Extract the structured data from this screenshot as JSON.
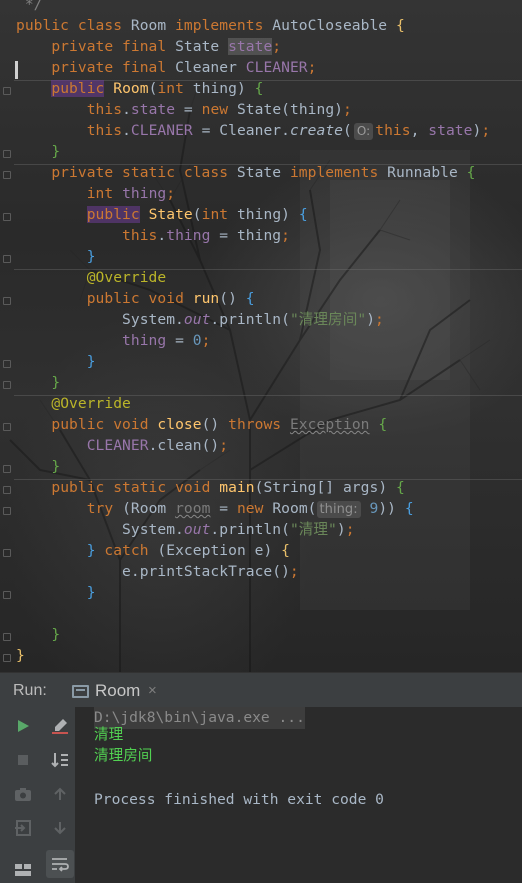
{
  "editor": {
    "lines": [
      {
        "segments": [
          {
            "t": " */",
            "c": "cmt"
          }
        ]
      },
      {
        "segments": [
          {
            "t": "public class ",
            "c": "kw"
          },
          {
            "t": "Room "
          },
          {
            "t": "implements ",
            "c": "kw"
          },
          {
            "t": "AutoCloseable "
          },
          {
            "t": "{",
            "c": "brace-y"
          }
        ]
      },
      {
        "segments": [
          {
            "t": "    private final ",
            "c": "kw"
          },
          {
            "t": "State "
          },
          {
            "t": "state",
            "c": "fld hlbox"
          },
          {
            "t": ";",
            "c": "kw"
          }
        ]
      },
      {
        "segments": [
          {
            "t": "    private final ",
            "c": "kw"
          },
          {
            "t": "Cleaner "
          },
          {
            "t": "CLEANER",
            "c": "fld"
          },
          {
            "t": ";",
            "c": "kw"
          }
        ]
      },
      {
        "segments": [
          {
            "t": "    "
          },
          {
            "t": "public",
            "c": "kw kwbox"
          },
          {
            "t": " "
          },
          {
            "t": "Room",
            "c": "fn"
          },
          {
            "t": "("
          },
          {
            "t": "int ",
            "c": "kw"
          },
          {
            "t": "thing) "
          },
          {
            "t": "{",
            "c": "brace-g"
          }
        ]
      },
      {
        "segments": [
          {
            "t": "        "
          },
          {
            "t": "this",
            "c": "kw"
          },
          {
            "t": "."
          },
          {
            "t": "state",
            "c": "fld"
          },
          {
            "t": " = "
          },
          {
            "t": "new ",
            "c": "kw"
          },
          {
            "t": "State(thing)"
          },
          {
            "t": ";",
            "c": "kw"
          }
        ]
      },
      {
        "segments": [
          {
            "t": "        "
          },
          {
            "t": "this",
            "c": "kw"
          },
          {
            "t": "."
          },
          {
            "t": "CLEANER",
            "c": "fld"
          },
          {
            "t": " = Cleaner."
          },
          {
            "t": "create",
            "c": "ital"
          },
          {
            "t": "("
          },
          {
            "t": "O:",
            "c": "lambda"
          },
          {
            "t": "this",
            "c": "kw"
          },
          {
            "t": ", "
          },
          {
            "t": "state",
            "c": "fld"
          },
          {
            "t": ")"
          },
          {
            "t": ";",
            "c": "kw"
          }
        ]
      },
      {
        "segments": [
          {
            "t": "    "
          },
          {
            "t": "}",
            "c": "brace-g"
          }
        ]
      },
      {
        "segments": [
          {
            "t": "    private static class ",
            "c": "kw"
          },
          {
            "t": "State "
          },
          {
            "t": "implements ",
            "c": "kw"
          },
          {
            "t": "Runnable "
          },
          {
            "t": "{",
            "c": "brace-g"
          }
        ]
      },
      {
        "segments": [
          {
            "t": "        "
          },
          {
            "t": "int ",
            "c": "kw"
          },
          {
            "t": "thing",
            "c": "fld"
          },
          {
            "t": ";",
            "c": "kw"
          }
        ]
      },
      {
        "segments": [
          {
            "t": "        "
          },
          {
            "t": "public",
            "c": "kw kwbox"
          },
          {
            "t": " "
          },
          {
            "t": "State",
            "c": "fn"
          },
          {
            "t": "("
          },
          {
            "t": "int ",
            "c": "kw"
          },
          {
            "t": "thing) "
          },
          {
            "t": "{",
            "c": "brace-b"
          }
        ]
      },
      {
        "segments": [
          {
            "t": "            "
          },
          {
            "t": "this",
            "c": "kw"
          },
          {
            "t": "."
          },
          {
            "t": "thing",
            "c": "fld"
          },
          {
            "t": " = thing"
          },
          {
            "t": ";",
            "c": "kw"
          }
        ]
      },
      {
        "segments": [
          {
            "t": "        "
          },
          {
            "t": "}",
            "c": "brace-b"
          }
        ]
      },
      {
        "segments": [
          {
            "t": "        "
          },
          {
            "t": "@Override",
            "c": "ann"
          }
        ]
      },
      {
        "segments": [
          {
            "t": "        "
          },
          {
            "t": "public void ",
            "c": "kw"
          },
          {
            "t": "run",
            "c": "fn"
          },
          {
            "t": "() "
          },
          {
            "t": "{",
            "c": "brace-b"
          }
        ]
      },
      {
        "segments": [
          {
            "t": "            System."
          },
          {
            "t": "out",
            "c": "fld ital"
          },
          {
            "t": ".println("
          },
          {
            "t": "\"清理房间\"",
            "c": "str"
          },
          {
            "t": ")"
          },
          {
            "t": ";",
            "c": "kw"
          }
        ]
      },
      {
        "segments": [
          {
            "t": "            "
          },
          {
            "t": "thing",
            "c": "fld"
          },
          {
            "t": " = "
          },
          {
            "t": "0",
            "c": "num"
          },
          {
            "t": ";",
            "c": "kw"
          }
        ]
      },
      {
        "segments": [
          {
            "t": "        "
          },
          {
            "t": "}",
            "c": "brace-b"
          }
        ]
      },
      {
        "segments": [
          {
            "t": "    "
          },
          {
            "t": "}",
            "c": "brace-g"
          }
        ]
      },
      {
        "segments": [
          {
            "t": "    "
          },
          {
            "t": "@Override",
            "c": "ann"
          }
        ]
      },
      {
        "segments": [
          {
            "t": "    "
          },
          {
            "t": "public void ",
            "c": "kw"
          },
          {
            "t": "close",
            "c": "fn"
          },
          {
            "t": "() "
          },
          {
            "t": "throws ",
            "c": "kw"
          },
          {
            "t": "Exception",
            "c": "unused"
          },
          {
            "t": " "
          },
          {
            "t": "{",
            "c": "brace-g"
          }
        ]
      },
      {
        "segments": [
          {
            "t": "        "
          },
          {
            "t": "CLEANER",
            "c": "fld"
          },
          {
            "t": ".clean()"
          },
          {
            "t": ";",
            "c": "kw"
          }
        ]
      },
      {
        "segments": [
          {
            "t": "    "
          },
          {
            "t": "}",
            "c": "brace-g"
          }
        ]
      },
      {
        "segments": [
          {
            "t": "    "
          },
          {
            "t": "public static void ",
            "c": "kw"
          },
          {
            "t": "main",
            "c": "fn"
          },
          {
            "t": "(String[] args) "
          },
          {
            "t": "{",
            "c": "brace-g"
          }
        ]
      },
      {
        "segments": [
          {
            "t": "        "
          },
          {
            "t": "try ",
            "c": "kw"
          },
          {
            "t": "(Room "
          },
          {
            "t": "room",
            "c": "unused"
          },
          {
            "t": " = "
          },
          {
            "t": "new ",
            "c": "kw"
          },
          {
            "t": "Room("
          },
          {
            "t": "thing:",
            "c": "hint"
          },
          {
            "t": " "
          },
          {
            "t": "9",
            "c": "num"
          },
          {
            "t": ")) "
          },
          {
            "t": "{",
            "c": "brace-b"
          }
        ]
      },
      {
        "segments": [
          {
            "t": "            System."
          },
          {
            "t": "out",
            "c": "fld ital"
          },
          {
            "t": ".println("
          },
          {
            "t": "\"清理\"",
            "c": "str"
          },
          {
            "t": ")"
          },
          {
            "t": ";",
            "c": "kw"
          }
        ]
      },
      {
        "segments": [
          {
            "t": "        "
          },
          {
            "t": "}",
            "c": "brace-b"
          },
          {
            "t": " "
          },
          {
            "t": "catch ",
            "c": "kw"
          },
          {
            "t": "(Exception e) "
          },
          {
            "t": "{",
            "c": "brace-y"
          }
        ]
      },
      {
        "segments": [
          {
            "t": "            e.printStackTrace()"
          },
          {
            "t": ";",
            "c": "kw"
          }
        ]
      },
      {
        "segments": [
          {
            "t": "        "
          },
          {
            "t": "}",
            "c": "brace-b"
          }
        ]
      },
      {
        "segments": [
          {
            "t": ""
          }
        ]
      },
      {
        "segments": [
          {
            "t": "    "
          },
          {
            "t": "}",
            "c": "brace-g"
          }
        ]
      },
      {
        "segments": [
          {
            "t": "}",
            "c": "brace-y"
          }
        ]
      }
    ]
  },
  "run_panel": {
    "label": "Run:",
    "tab_title": "Room",
    "tab_close": "×",
    "console": {
      "command": "D:\\jdk8\\bin\\java.exe ...",
      "output_lines": [
        "清理",
        "清理房间"
      ],
      "exit_message": "Process finished with exit code 0"
    },
    "toolbar_icons": [
      "run-icon",
      "stop-icon",
      "camera-icon",
      "login-icon",
      "layout-icon",
      "clear-icon",
      "sort-icon",
      "up-arrow-icon",
      "down-arrow-icon",
      "wrap-icon"
    ]
  },
  "colors": {
    "keyword": "#cc7832",
    "function": "#ffc66d",
    "field": "#9876aa",
    "string": "#6a8759",
    "number": "#6897bb",
    "annotation": "#bbb529",
    "console_output": "#52d152",
    "run_green": "#59a869"
  }
}
